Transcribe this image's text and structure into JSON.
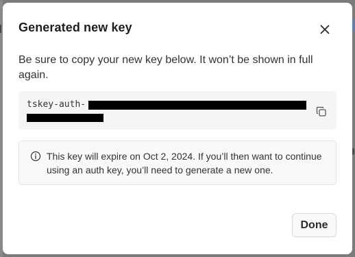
{
  "dialog": {
    "title": "Generated new key",
    "description": "Be sure to copy your new key below. It won’t be shown in full again.",
    "key_prefix": "tskey-auth-",
    "info_text": "This key will expire on Oct 2, 2024. If you’ll then want to continue using an auth key, you’ll need to generate a new one.",
    "done_label": "Done"
  },
  "icons": {
    "close": "close-icon",
    "copy": "copy-icon",
    "info": "info-icon"
  },
  "colors": {
    "title": "#1f1e1e",
    "text": "#333131",
    "key_box_bg": "#f7f5f4",
    "overlay": "#7b7b7b"
  }
}
